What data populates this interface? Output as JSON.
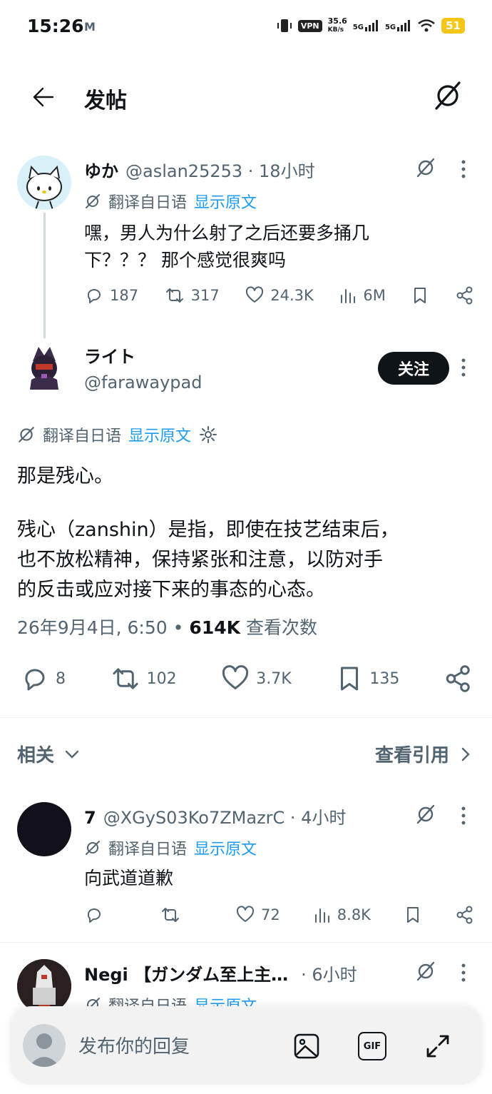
{
  "status_bar": {
    "time": "15:26",
    "mail_glyph": "M",
    "vpn": "VPN",
    "speed_value": "35.6",
    "speed_unit": "KB/s",
    "net1": "5G",
    "net2": "5G",
    "battery": "51"
  },
  "header": {
    "title": "发帖"
  },
  "parent_tweet": {
    "name": "ゆか",
    "meta": "@aslan25253 · 18小时",
    "translate_label": "翻译自日语",
    "show_original": "显示原文",
    "text_line1": "嘿，男人为什么射了之后还要多捅几",
    "text_line2": "下？？？ 那个感觉很爽吗",
    "replies": "187",
    "retweets": "317",
    "likes": "24.3K",
    "views": "6M"
  },
  "main_tweet": {
    "name": "ライト",
    "handle": "@farawaypad",
    "follow_label": "关注",
    "translate_label": "翻译自日语",
    "show_original": "显示原文",
    "para1": "那是残心。",
    "para2_line1": "残心（zanshin）是指，即使在技艺结束后，",
    "para2_line2": "也不放松精神，保持紧张和注意，以防对手",
    "para2_line3": "的反击或应对接下来的事态的心态。",
    "timestamp": "26年9月4日, 6:50",
    "view_count": "614K",
    "view_label": "查看次数",
    "replies": "8",
    "retweets": "102",
    "likes": "3.7K",
    "bookmarks": "135"
  },
  "related_section": {
    "label": "相关",
    "quotes_link": "查看引用"
  },
  "reply1": {
    "name": "7",
    "meta": "@XGyS03Ko7ZMazrC · 4小时",
    "translate_label": "翻译自日语",
    "show_original": "显示原文",
    "text": "向武道道歉",
    "likes": "72",
    "views": "8.8K"
  },
  "reply2": {
    "name": "Negi 【ガンダム至上主…",
    "meta": "· 6小时",
    "translate_label": "翻译自日语",
    "show_original": "显示原文"
  },
  "reply_bar": {
    "placeholder": "发布你的回复",
    "gif_label": "GIF"
  },
  "colors": {
    "text": "#0f1419",
    "secondary": "#536471",
    "link": "#1d9bf0",
    "button_dark": "#0f1419",
    "battery": "#f5c518"
  }
}
